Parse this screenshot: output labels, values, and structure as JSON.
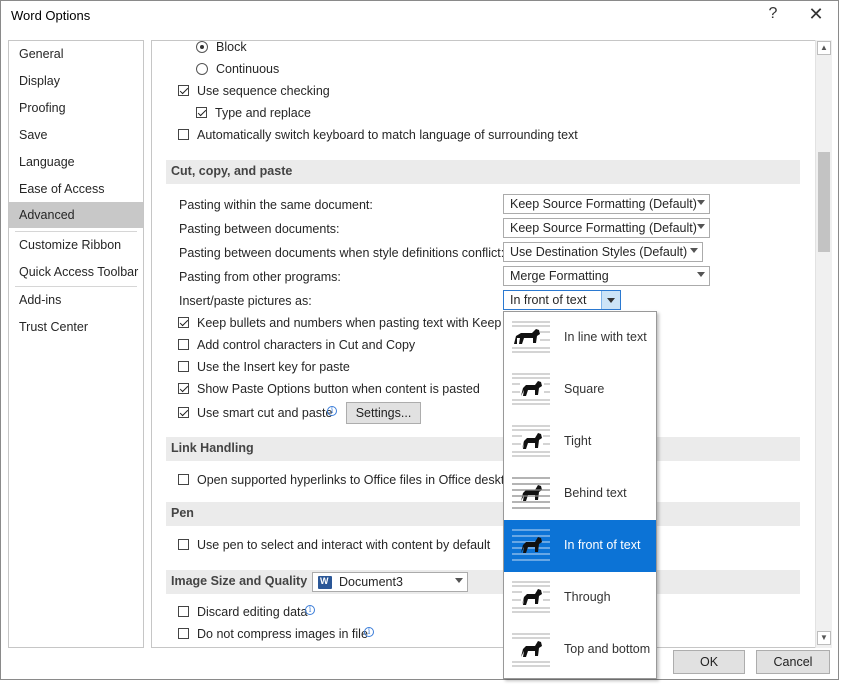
{
  "window": {
    "title": "Word Options",
    "help": "?",
    "close": "✕"
  },
  "sidebar": {
    "items": [
      {
        "label": "General"
      },
      {
        "label": "Display"
      },
      {
        "label": "Proofing"
      },
      {
        "label": "Save"
      },
      {
        "label": "Language"
      },
      {
        "label": "Ease of Access"
      },
      {
        "label": "Advanced",
        "active": true
      },
      {
        "label": "Customize Ribbon"
      },
      {
        "label": "Quick Access Toolbar"
      },
      {
        "label": "Add-ins"
      },
      {
        "label": "Trust Center"
      }
    ]
  },
  "top_options": {
    "radio_block": "Block",
    "radio_continuous": "Continuous",
    "use_sequence_checking": "Use sequence checking",
    "type_and_replace": "Type and replace",
    "auto_switch_keyboard": "Automatically switch keyboard to match language of surrounding text"
  },
  "cut_copy_paste": {
    "header": "Cut, copy, and paste",
    "rows": [
      {
        "label": "Pasting within the same document:",
        "value": "Keep Source Formatting (Default)"
      },
      {
        "label": "Pasting between documents:",
        "value": "Keep Source Formatting (Default)"
      },
      {
        "label": "Pasting between documents when style definitions conflict:",
        "value": "Use Destination Styles (Default)"
      },
      {
        "label": "Pasting from other programs:",
        "value": "Merge Formatting"
      },
      {
        "label": "Insert/paste pictures as:",
        "value": "In front of text"
      }
    ],
    "keep_bullets": "Keep bullets and numbers when pasting text with Keep Tex",
    "add_control_chars": "Add control characters in Cut and Copy",
    "use_insert_key": "Use the Insert key for paste",
    "show_paste_options": "Show Paste Options button when content is pasted",
    "use_smart_cut": "Use smart cut and paste",
    "settings_button": "Settings..."
  },
  "link_handling": {
    "header": "Link Handling",
    "open_hyperlinks": "Open supported hyperlinks to Office files in Office desktop"
  },
  "pen": {
    "header": "Pen",
    "use_pen": "Use pen to select and interact with content by default"
  },
  "image_size": {
    "header": "Image Size and Quality",
    "document": "Document3",
    "discard_editing": "Discard editing data",
    "do_not_compress": "Do not compress images in file"
  },
  "wrap_dropdown": {
    "items": [
      {
        "label": "In line with text",
        "icon": "inline-wrap-icon"
      },
      {
        "label": "Square",
        "icon": "square-wrap-icon"
      },
      {
        "label": "Tight",
        "icon": "tight-wrap-icon"
      },
      {
        "label": "Behind text",
        "icon": "behind-text-icon"
      },
      {
        "label": "In front of text",
        "icon": "in-front-of-text-icon",
        "selected": true
      },
      {
        "label": "Through",
        "icon": "through-wrap-icon"
      },
      {
        "label": "Top and bottom",
        "icon": "top-bottom-wrap-icon"
      }
    ]
  },
  "footer": {
    "ok": "OK",
    "cancel": "Cancel"
  },
  "colors": {
    "selection": "#0c73d6",
    "sidebar_active": "#c8c8c8",
    "section_bg": "#ebebeb"
  }
}
